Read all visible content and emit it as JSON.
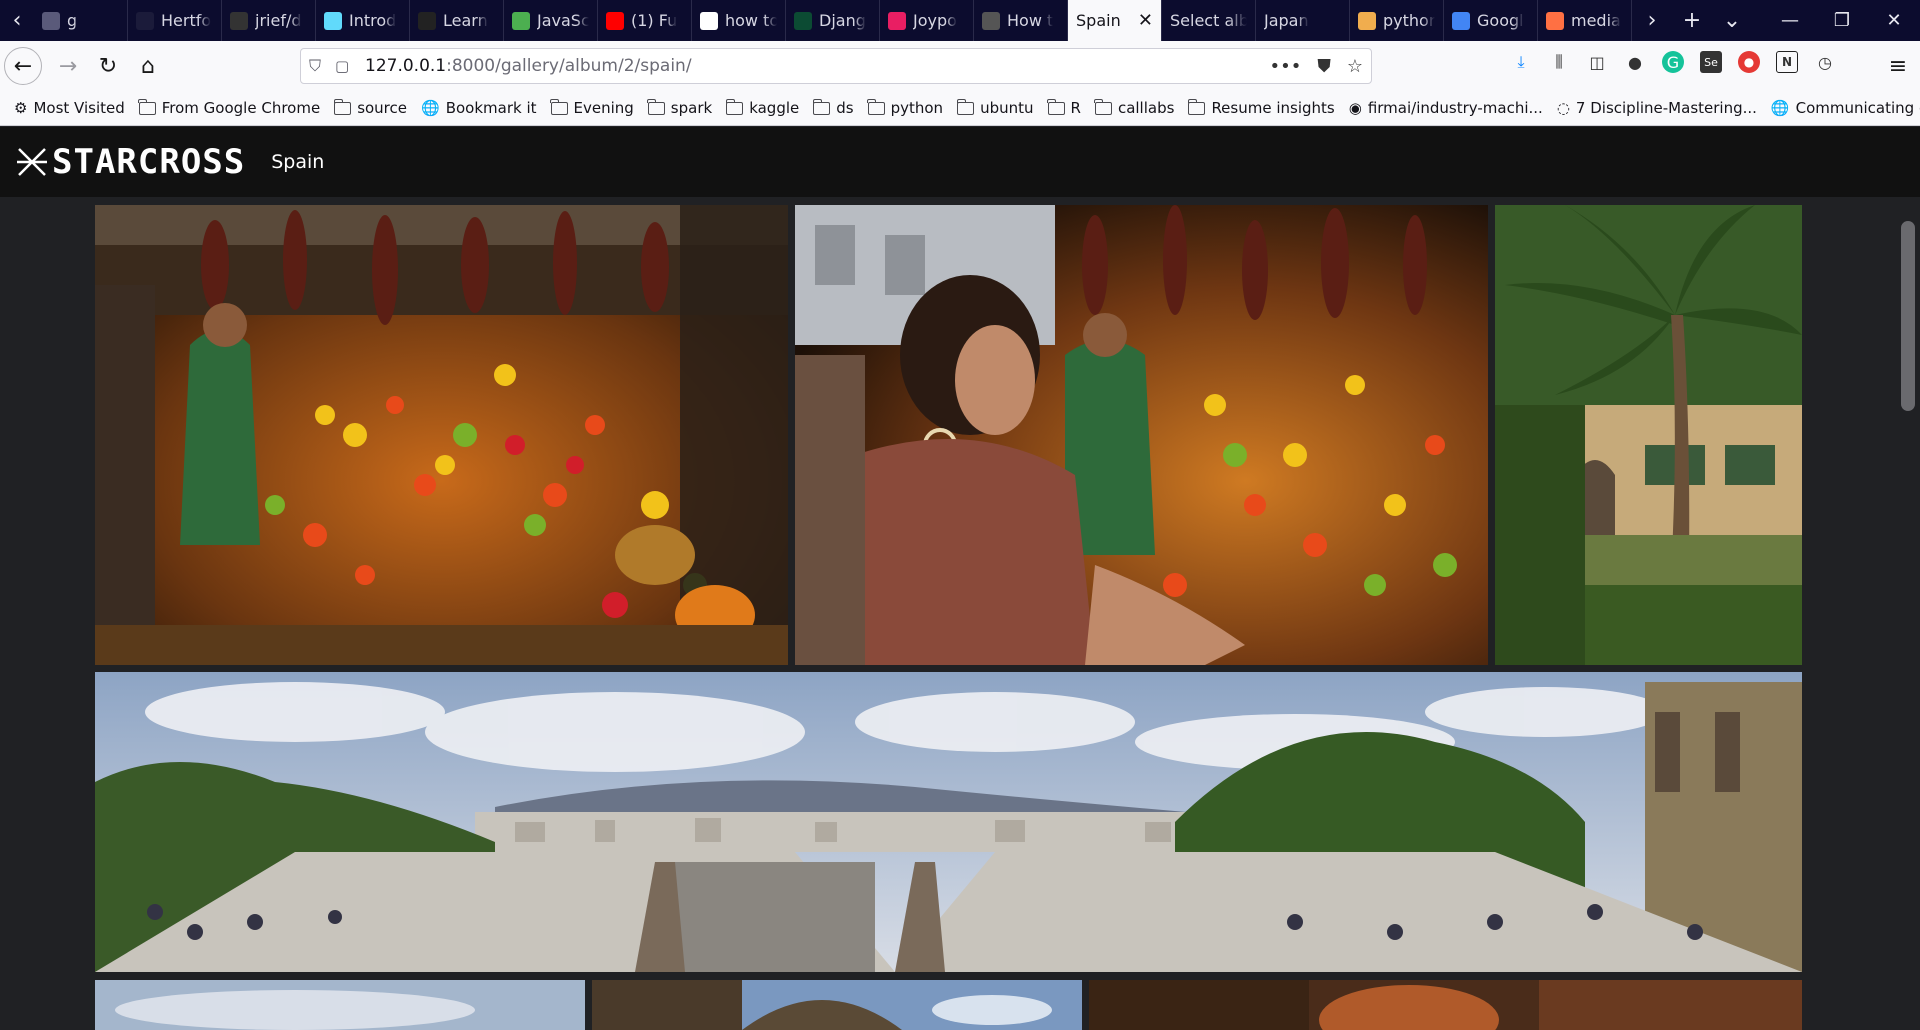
{
  "browser": {
    "tabs": [
      {
        "label": "g",
        "icon": "generic-icon",
        "color": "#5a5a7a"
      },
      {
        "label": "Hertfo",
        "icon": "star-logo-icon",
        "color": "#1b1b3a"
      },
      {
        "label": "jrief/d",
        "icon": "github-icon",
        "color": "#333"
      },
      {
        "label": "Introd",
        "icon": "react-icon",
        "color": "#61dafb"
      },
      {
        "label": "Learn",
        "icon": "learn-icon",
        "color": "#222"
      },
      {
        "label": "JavaSc",
        "icon": "js-icon",
        "color": "#4caf50"
      },
      {
        "label": "(1) Fu",
        "icon": "youtube-icon",
        "color": "#ff0000"
      },
      {
        "label": "how to",
        "icon": "google-icon",
        "color": "#ffffff"
      },
      {
        "label": "Djang",
        "icon": "django-icon",
        "color": "#0c4b33"
      },
      {
        "label": "Joypo",
        "icon": "heart-icon",
        "color": "#e91e63"
      },
      {
        "label": "How t",
        "icon": "slash-icon",
        "color": "#555"
      },
      {
        "label": "Spain",
        "icon": "",
        "color": "",
        "active": true
      },
      {
        "label": "Select albu",
        "icon": "",
        "color": ""
      },
      {
        "label": "Japan",
        "icon": "",
        "color": ""
      },
      {
        "label": "pythor",
        "icon": "python-icon",
        "color": "#f0ad4e"
      },
      {
        "label": "Googl",
        "icon": "google-icon",
        "color": "#4285f4"
      },
      {
        "label": "media",
        "icon": "media-icon",
        "color": "#ff7043"
      }
    ],
    "url": {
      "host": "127.0.0.1",
      "path": ":8000/gallery/album/2/spain/"
    },
    "bookmarks": [
      {
        "label": "Most Visited",
        "icon": "gear-icon"
      },
      {
        "label": "From Google Chrome",
        "icon": "folder-icon"
      },
      {
        "label": "source",
        "icon": "folder-icon"
      },
      {
        "label": "Bookmark it",
        "icon": "globe-icon"
      },
      {
        "label": "Evening",
        "icon": "folder-icon"
      },
      {
        "label": "spark",
        "icon": "folder-icon"
      },
      {
        "label": "kaggle",
        "icon": "folder-icon"
      },
      {
        "label": "ds",
        "icon": "folder-icon"
      },
      {
        "label": "python",
        "icon": "folder-icon"
      },
      {
        "label": "ubuntu",
        "icon": "folder-icon"
      },
      {
        "label": "R",
        "icon": "folder-icon"
      },
      {
        "label": "calllabs",
        "icon": "folder-icon"
      },
      {
        "label": "Resume insights",
        "icon": "folder-icon"
      },
      {
        "label": "firmai/industry-machi...",
        "icon": "github-icon"
      },
      {
        "label": "7 Discipline-Mastering...",
        "icon": "loading-icon"
      },
      {
        "label": "Communicating data s...",
        "icon": "globe-icon"
      }
    ]
  },
  "site": {
    "logo": "STARCROSS",
    "album_title": "Spain"
  },
  "gallery": {
    "photos": [
      {
        "name": "photo-market-stall-1",
        "subject": "fruit market stall"
      },
      {
        "name": "photo-market-stall-2",
        "subject": "fruit market with woman"
      },
      {
        "name": "photo-palm-building",
        "subject": "palm tree and building"
      },
      {
        "name": "photo-panorama-barcelona",
        "subject": "barcelona panorama"
      },
      {
        "name": "photo-sky-1",
        "subject": "sky"
      },
      {
        "name": "photo-dome",
        "subject": "dome and sky"
      },
      {
        "name": "photo-interior",
        "subject": "ornate interior"
      }
    ]
  }
}
